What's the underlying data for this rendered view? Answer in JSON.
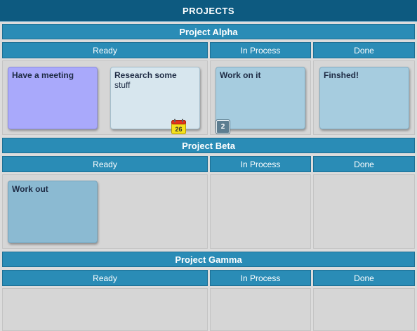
{
  "title": "PROJECTS",
  "columns": [
    "Ready",
    "In Process",
    "Done"
  ],
  "projects": [
    {
      "name": "Project Alpha",
      "cards": [
        {
          "title": "Have a meeting",
          "detail": "",
          "column": "Ready",
          "color": "#a9a9fb"
        },
        {
          "title": "Research some",
          "detail": "stuff",
          "column": "Ready",
          "color": "#d7e6ee",
          "calendar_day": "26"
        },
        {
          "title": "Work on it",
          "detail": "",
          "column": "In Process",
          "color": "#a6ccdf",
          "badge_count": "2"
        },
        {
          "title": "Finshed!",
          "detail": "",
          "column": "Done",
          "color": "#a6ccdf"
        }
      ]
    },
    {
      "name": "Project Beta",
      "cards": [
        {
          "title": "Work out",
          "detail": "",
          "column": "Ready",
          "color": "#8bbad2"
        }
      ]
    },
    {
      "name": "Project Gamma",
      "cards": []
    }
  ],
  "icons": {
    "calendar": "calendar-icon",
    "badge": "count-badge"
  },
  "colors": {
    "header": "#0d5a80",
    "band": "#2a8cb6",
    "lane": "#d6d6d6"
  }
}
